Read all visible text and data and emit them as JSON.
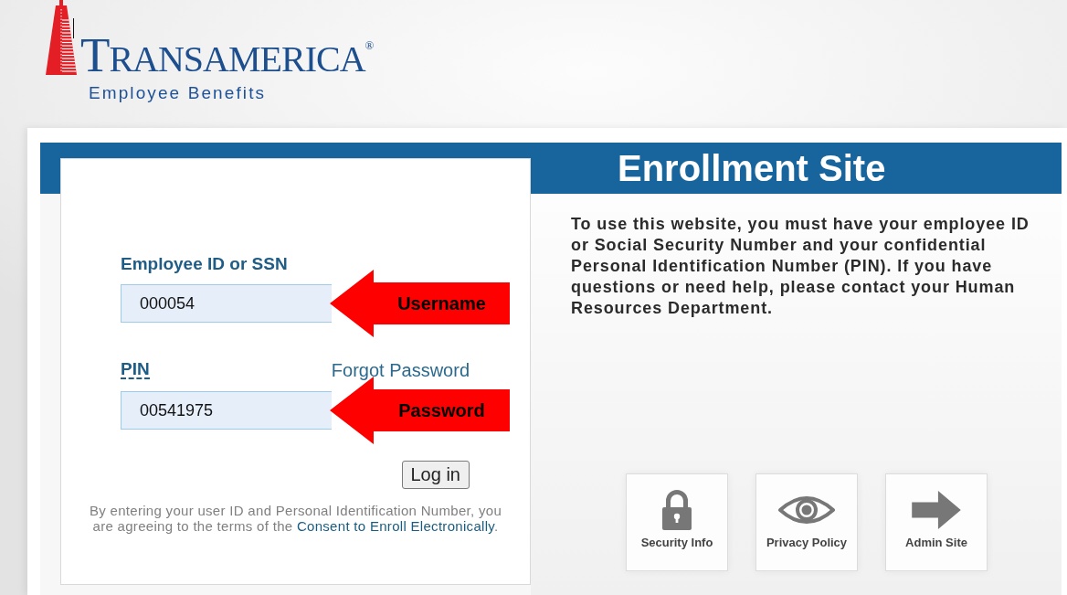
{
  "logo": {
    "wordmark": "TRANSAMERICA$^{®}$",
    "tagline": "Employee Benefits"
  },
  "banner": {
    "title": "Enrollment Site"
  },
  "login": {
    "fields": [
      {
        "label": "Employee ID or SSN",
        "abbr": false,
        "value": "000054",
        "annotation": "Username"
      },
      {
        "label": "PIN",
        "abbr": true,
        "link": "Forgot Password",
        "value": "00541975",
        "annotation": "Password"
      }
    ],
    "button": "Log in",
    "disclaimer": {
      "before": "By entering your user ID and Personal Identification Number, you are agreeing to the terms of the ",
      "link": "Consent to Enroll Electronically",
      "after": "."
    }
  },
  "intro": "To use this website, you must have your employee ID or Social Security Number and your confidential Personal Identification Number (PIN). If you have questions or need help, please contact your Human Resources Department.",
  "tiles": [
    {
      "kind": "security",
      "label": "Security Info"
    },
    {
      "kind": "privacy",
      "label": "Privacy Policy"
    },
    {
      "kind": "admin",
      "label": "Admin Site"
    }
  ]
}
